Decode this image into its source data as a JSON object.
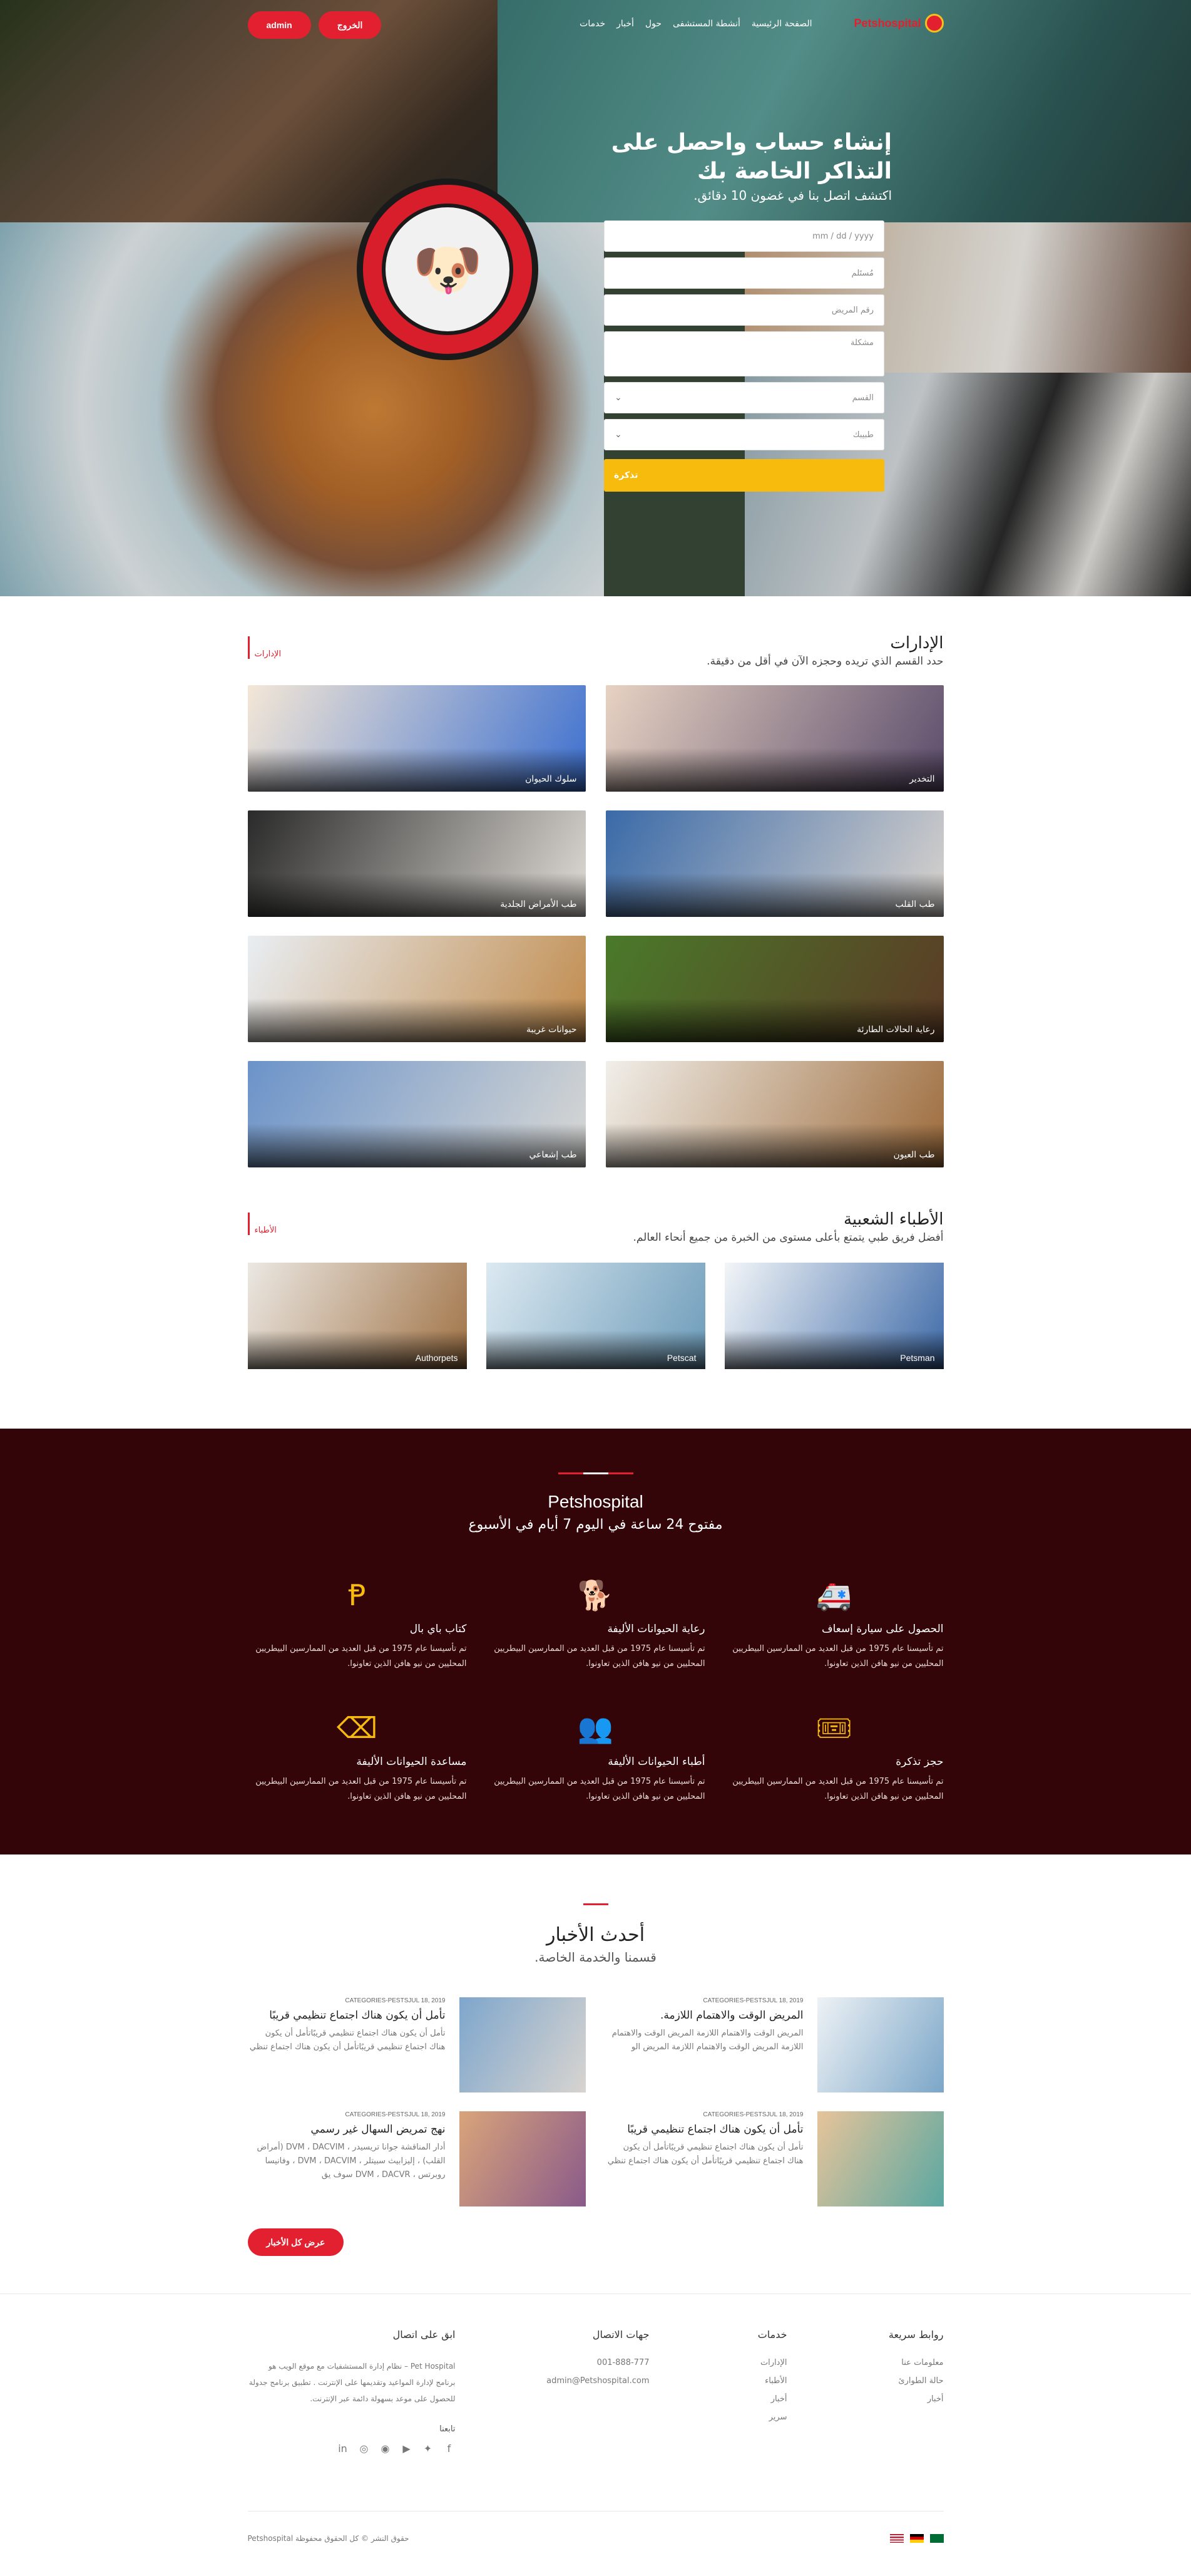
{
  "nav": {
    "logo_text": "Petshospital",
    "menu": [
      "الصفحة الرئيسية",
      "أنشطة المستشفى",
      "حول",
      "أخبار",
      "خدمات"
    ],
    "logout_label": "الخروج",
    "admin_label": "admin"
  },
  "hero": {
    "title": "إنشاء حساب واحصل على التذاكر الخاصة بك",
    "subtitle": "اكتشف اتصل بنا في غضون 10 دقائق.",
    "form": {
      "date_placeholder": "mm / dd / yyyy",
      "surname_placeholder": "مُستَلم",
      "patient_number_placeholder": "رقم المريض",
      "problem_placeholder": "مشكلة",
      "department_select": "القسم",
      "doctor_select": "طبيبك",
      "submit_label": "تذكرة"
    }
  },
  "departments": {
    "title": "الإدارات",
    "subtitle": "حدد القسم الذي تريده وحجزه الآن في أقل من دقيقة.",
    "tag": "الإدارات",
    "items": [
      {
        "label": "التخدير",
        "color_a": "#e7d2c2",
        "color_b": "#5a4b6b"
      },
      {
        "label": "سلوك الحيوان",
        "color_a": "#f4e7d6",
        "color_b": "#3c6fcf"
      },
      {
        "label": "طب القلب",
        "color_a": "#3a6aa8",
        "color_b": "#d9d3cd"
      },
      {
        "label": "طب الأمراض الجلدية",
        "color_a": "#2a2a2a",
        "color_b": "#e1ddd7"
      },
      {
        "label": "رعاية الحالات الطارئة",
        "color_a": "#4a7a2a",
        "color_b": "#5b3a25"
      },
      {
        "label": "حيوانات غريبة",
        "color_a": "#e9eef3",
        "color_b": "#c08a4b"
      },
      {
        "label": "طب العيون",
        "color_a": "#f1efea",
        "color_b": "#9c6a3a"
      },
      {
        "label": "طب إشعاعي",
        "color_a": "#6b93c9",
        "color_b": "#d9d8d4"
      }
    ]
  },
  "doctors": {
    "title": "الأطباء الشعبية",
    "subtitle": "أفضل فريق طبي يتمتع بأعلى مستوى من الخبرة من جميع أنحاء العالم.",
    "tag": "الأطباء",
    "items": [
      {
        "name": "Petsman",
        "color_a": "#f3f6f8",
        "color_b": "#3e6aa8"
      },
      {
        "name": "Petscat",
        "color_a": "#dce9f1",
        "color_b": "#6c9bb9"
      },
      {
        "name": "Authorpets",
        "color_a": "#ebe8e3",
        "color_b": "#a07245"
      }
    ]
  },
  "services": {
    "brand": "Petshospital",
    "subtitle": "مفتوح 24 ساعة في اليوم 7 أيام في الأسبوع",
    "accent": "#f6bb0c",
    "items": [
      {
        "icon": "ambulance-icon",
        "glyph": "🚑",
        "title": "الحصول على سيارة إسعاف",
        "text": "تم تأسيسنا عام 1975 من قبل العديد من الممارسين البيطريين المحليين من نيو هافن الذين تعاونوا."
      },
      {
        "icon": "dog-walk-icon",
        "glyph": "🐕",
        "title": "رعاية الحيوانات الأليفة",
        "text": "تم تأسيسنا عام 1975 من قبل العديد من الممارسين البيطريين المحليين من نيو هافن الذين تعاونوا."
      },
      {
        "icon": "paypal-icon",
        "glyph": "Ᵽ",
        "title": "كتاب باي بال",
        "text": "تم تأسيسنا عام 1975 من قبل العديد من الممارسين البيطريين المحليين من نيو هافن الذين تعاونوا."
      },
      {
        "icon": "ticket-icon",
        "glyph": "🎟",
        "title": "حجز تذكرة",
        "text": "تم تأسيسنا عام 1975 من قبل العديد من الممارسين البيطريين المحليين من نيو هافن الذين تعاونوا."
      },
      {
        "icon": "doctors-icon",
        "glyph": "👥",
        "title": "أطباء الحيوانات الأليفة",
        "text": "تم تأسيسنا عام 1975 من قبل العديد من الممارسين البيطريين المحليين من نيو هافن الذين تعاونوا."
      },
      {
        "icon": "pet-help-icon",
        "glyph": "⌫",
        "title": "مساعدة الحيوانات الأليفة",
        "text": "تم تأسيسنا عام 1975 من قبل العديد من الممارسين البيطريين المحليين من نيو هافن الذين تعاونوا."
      }
    ]
  },
  "news": {
    "title": "أحدث الأخبار",
    "subtitle": "قسمنا والخدمة الخاصة.",
    "view_all": "عرض كل الأخبار",
    "posts": [
      {
        "category": "CATEGORIES-PESTS",
        "date": "JUL 18, 2019",
        "title": "المريض الوقت والاهتمام اللازمة.",
        "text": "المريض الوقت والاهتمام اللازمة المريض الوقت والاهتمام اللازمة المريض الوقت والاهتمام اللازمة المريض الو",
        "color_a": "#eef2f5",
        "color_b": "#7ba6c8"
      },
      {
        "category": "CATEGORIES-PESTS",
        "date": "JUL 18, 2019",
        "title": "تأمل أن يكون هناك اجتماع تنظيمي قريبًا",
        "text": "تأمل أن يكون هناك اجتماع تنظيمي قريبًاتأمل أن يكون هناك اجتماع تنظيمي قريبًاتأمل أن يكون هناك اجتماع تنظي",
        "color_a": "#7ea6cc",
        "color_b": "#d8d4d0"
      },
      {
        "category": "CATEGORIES-PESTS",
        "date": "JUL 18, 2019",
        "title": "تأمل أن يكون هناك اجتماع تنظيمي قريبًا",
        "text": "تأمل أن يكون هناك اجتماع تنظيمي قريبًاتأمل أن يكون هناك اجتماع تنظيمي قريبًاتأمل أن يكون هناك اجتماع تنظي",
        "color_a": "#e7c49a",
        "color_b": "#5aa7a1"
      },
      {
        "category": "CATEGORIES-PESTS",
        "date": "JUL 18, 2019",
        "title": "نهج تمريض السهال غير رسمي",
        "text": "أدار المناقشة جوانا تريسيدر ، DVM ، DACVIM (أمراض القلب) ، إليزابيث سبيتلر ، DVM ، DACVIM ، وفانيسا روبرتس ، DVM ، DACVR سوف يق",
        "color_a": "#d9a47a",
        "color_b": "#8a5a8a"
      }
    ]
  },
  "footer": {
    "quick_links": {
      "title": "روابط سريعة",
      "items": [
        "معلومات عنا",
        "حالة الطوارئ",
        "أخبار"
      ]
    },
    "services": {
      "title": "خدمات",
      "items": [
        "الإدارات",
        "الأطباء",
        "أخبار",
        "سرير"
      ]
    },
    "contact": {
      "title": "جهات الاتصال",
      "phone": "001-888-777",
      "email": "admin@Petshospital.com"
    },
    "stay": {
      "title": "ابق على اتصال",
      "about": "Pet Hospital – نظام إدارة المستشفيات مع موقع الويب هو برنامج لإدارة المواعيد وتقديمها على الإنترنت . تطبيق برنامج جدولة للحصول على موعد بسهولة دائمة عبر الإنترنت.",
      "follow": "تابعنا"
    },
    "socials": [
      "facebook-icon",
      "twitter-icon",
      "youtube-icon",
      "github-icon",
      "dribbble-icon",
      "linkedin-icon"
    ],
    "copyright": "حقوق النشر © كل الحقوق محفوظة Petshospital"
  },
  "colors": {
    "brand_red": "#e3202f",
    "dark_bg": "#330509",
    "yellow": "#f6bb0c"
  }
}
